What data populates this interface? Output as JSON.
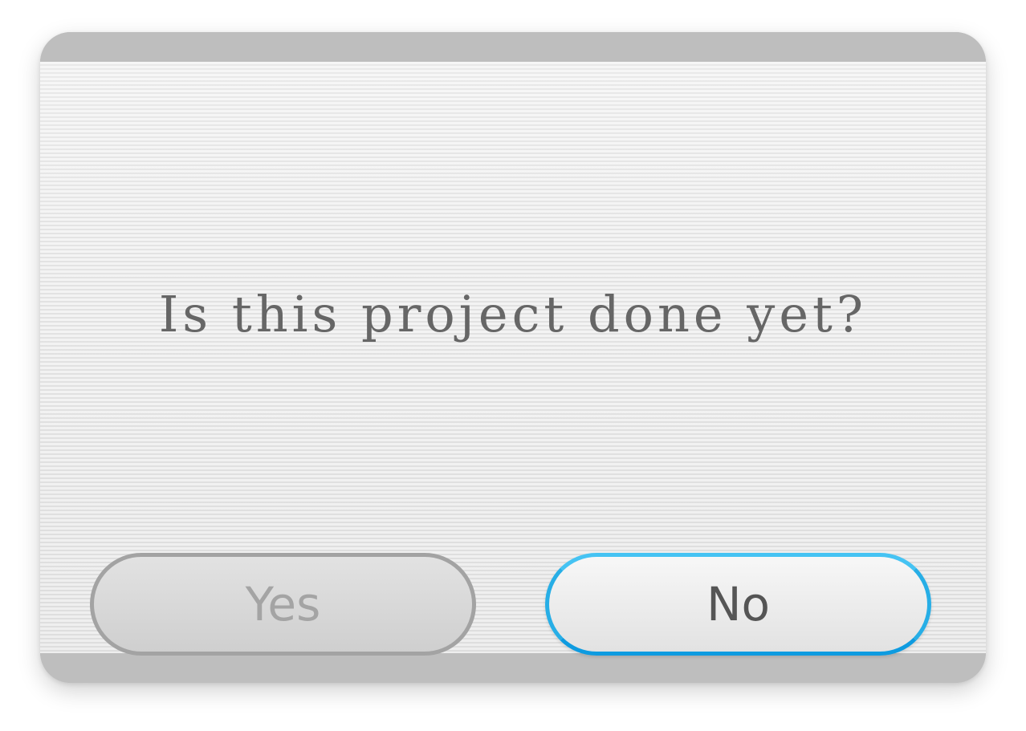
{
  "dialog": {
    "message": "Is this project done yet?",
    "buttons": {
      "yes_label": "Yes",
      "no_label": "No"
    }
  },
  "colors": {
    "frame": "#bebebe",
    "text": "#666666",
    "selected_outline": "#27aee6",
    "disabled_outline": "#a3a3a3"
  }
}
